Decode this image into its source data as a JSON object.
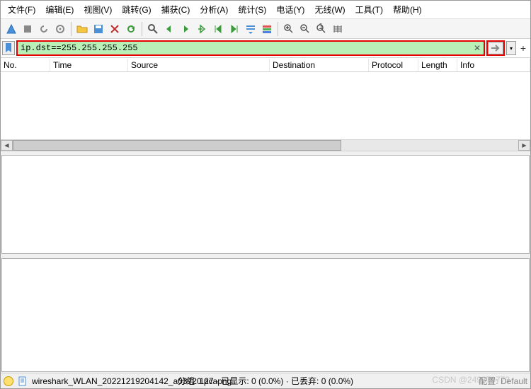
{
  "menu": {
    "file": "文件(F)",
    "edit": "编辑(E)",
    "view": "视图(V)",
    "go": "跳转(G)",
    "capture": "捕获(C)",
    "analyze": "分析(A)",
    "stats": "统计(S)",
    "telephony": "电话(Y)",
    "wireless": "无线(W)",
    "tools": "工具(T)",
    "help": "帮助(H)"
  },
  "filter": {
    "value": "ip.dst==255.255.255.255"
  },
  "columns": {
    "no": "No.",
    "time": "Time",
    "source": "Source",
    "destination": "Destination",
    "protocol": "Protocol",
    "length": "Length",
    "info": "Info"
  },
  "status": {
    "filename": "wireshark_WLAN_20221219204142_a03720.pcapng",
    "packets": "分组: 127",
    "displayed": "已显示: 0 (0.0%)",
    "dropped": "已丢弃: 0 (0.0%)",
    "profile": "配置: Default"
  },
  "watermark": "CSDN @249379773"
}
